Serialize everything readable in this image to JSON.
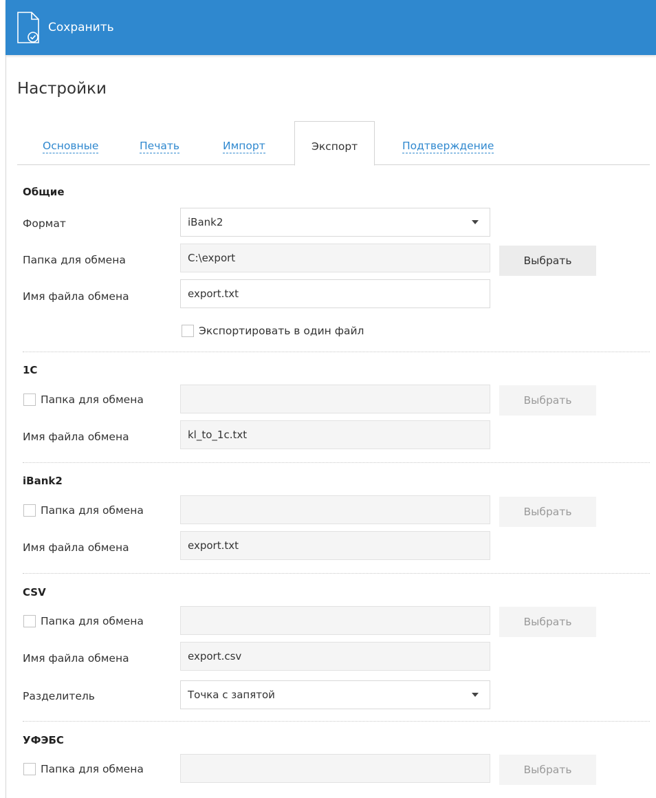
{
  "toolbar": {
    "save_label": "Сохранить",
    "icon": "document-check-icon"
  },
  "page": {
    "title": "Настройки"
  },
  "tabs": [
    {
      "label": "Основные"
    },
    {
      "label": "Печать"
    },
    {
      "label": "Импорт"
    },
    {
      "label": "Экспорт",
      "active": true
    },
    {
      "label": "Подтверждение"
    }
  ],
  "general": {
    "title": "Общие",
    "format_label": "Формат",
    "format_value": "iBank2",
    "folder_label": "Папка для обмена",
    "folder_value": "C:\\export",
    "choose_label": "Выбрать",
    "filename_label": "Имя файла обмена",
    "filename_value": "export.txt",
    "single_file_label": "Экспортировать в один файл"
  },
  "onec": {
    "title": "1С",
    "folder_label": "Папка для обмена",
    "folder_value": "",
    "choose_label": "Выбрать",
    "filename_label": "Имя файла обмена",
    "filename_value": "kl_to_1c.txt"
  },
  "ibank2": {
    "title": "iBank2",
    "folder_label": "Папка для обмена",
    "folder_value": "",
    "choose_label": "Выбрать",
    "filename_label": "Имя файла обмена",
    "filename_value": "export.txt"
  },
  "csv": {
    "title": "CSV",
    "folder_label": "Папка для обмена",
    "folder_value": "",
    "choose_label": "Выбрать",
    "filename_label": "Имя файла обмена",
    "filename_value": "export.csv",
    "separator_label": "Разделитель",
    "separator_value": "Точка с запятой"
  },
  "ufebs": {
    "title": "УФЭБС",
    "folder_label": "Папка для обмена",
    "folder_value": "",
    "choose_label": "Выбрать"
  },
  "colors": {
    "accent": "#2f88cf",
    "button_bg": "#ececec",
    "field_readonly_bg": "#f5f5f5"
  }
}
